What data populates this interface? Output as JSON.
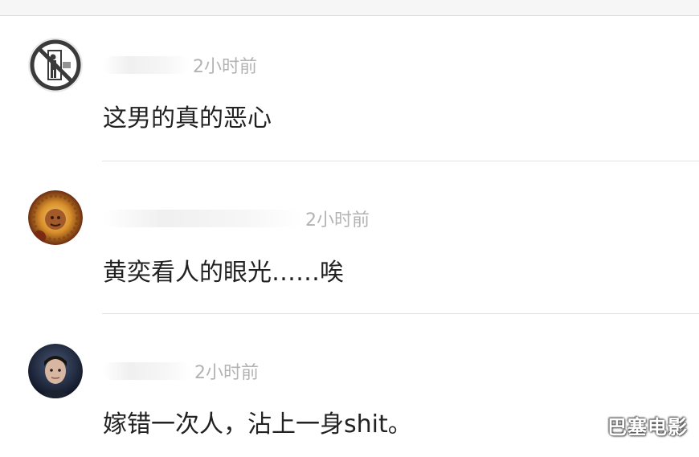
{
  "comments": [
    {
      "avatar_icon": "no-entry-sign-icon",
      "time": "2小时前",
      "text": "这男的真的恶心"
    },
    {
      "avatar_icon": "user-photo-avatar",
      "time": "2小时前",
      "text": "黄奕看人的眼光……唉"
    },
    {
      "avatar_icon": "user-photo-avatar",
      "time": "2小时前",
      "text": "嫁错一次人，沾上一身shit。"
    }
  ],
  "watermark": "巴塞电影",
  "colors": {
    "time": "#b3b3b3",
    "text": "#222222",
    "divider": "#e2e2e2"
  }
}
